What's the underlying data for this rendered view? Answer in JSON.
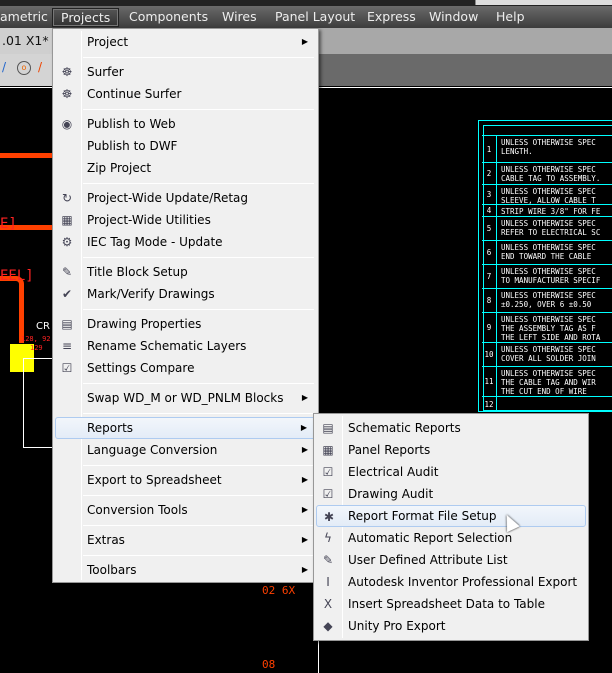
{
  "menubar": {
    "items": [
      {
        "label": "ametric"
      },
      {
        "label": "Projects"
      },
      {
        "label": "Components"
      },
      {
        "label": "Wires"
      },
      {
        "label": "Panel Layout"
      },
      {
        "label": "Express"
      },
      {
        "label": "Window"
      },
      {
        "label": "Help"
      }
    ]
  },
  "document_tab": {
    "label": ".01 X1*"
  },
  "projects_menu": {
    "items": [
      {
        "label": "Project",
        "icon": "none",
        "submenu": true
      },
      {
        "label": "Surfer",
        "icon": "surfer-icon"
      },
      {
        "label": "Continue Surfer",
        "icon": "continue-surfer-icon"
      },
      {
        "label": "Publish to Web",
        "icon": "globe-icon"
      },
      {
        "label": "Publish to DWF",
        "icon": "none"
      },
      {
        "label": "Zip Project",
        "icon": "none"
      },
      {
        "label": "Project-Wide Update/Retag",
        "icon": "update-icon"
      },
      {
        "label": "Project-Wide Utilities",
        "icon": "utilities-icon"
      },
      {
        "label": "IEC Tag Mode - Update",
        "icon": "iec-tag-icon"
      },
      {
        "label": "Title Block Setup",
        "icon": "title-block-icon"
      },
      {
        "label": "Mark/Verify Drawings",
        "icon": "check-icon"
      },
      {
        "label": "Drawing Properties",
        "icon": "properties-icon"
      },
      {
        "label": "Rename Schematic Layers",
        "icon": "rename-layers-icon"
      },
      {
        "label": "Settings Compare",
        "icon": "compare-icon"
      },
      {
        "label": "Swap WD_M or WD_PNLM Blocks",
        "icon": "none",
        "submenu": true
      },
      {
        "label": "Reports",
        "icon": "none",
        "submenu": true,
        "highlighted": true
      },
      {
        "label": "Language Conversion",
        "icon": "none",
        "submenu": true
      },
      {
        "label": "Export to Spreadsheet",
        "icon": "none",
        "submenu": true
      },
      {
        "label": "Conversion Tools",
        "icon": "none",
        "submenu": true
      },
      {
        "label": "Extras",
        "icon": "none",
        "submenu": true
      },
      {
        "label": "Toolbars",
        "icon": "none",
        "submenu": true
      }
    ]
  },
  "reports_submenu": {
    "items": [
      {
        "label": "Schematic Reports",
        "icon": "schematic-report-icon"
      },
      {
        "label": "Panel Reports",
        "icon": "panel-report-icon"
      },
      {
        "label": "Electrical Audit",
        "icon": "electrical-audit-icon"
      },
      {
        "label": "Drawing Audit",
        "icon": "drawing-audit-icon"
      },
      {
        "label": "Report Format File Setup",
        "icon": "report-format-icon",
        "highlighted": true
      },
      {
        "label": "Automatic Report Selection",
        "icon": "auto-report-icon"
      },
      {
        "label": "User Defined Attribute List",
        "icon": "attribute-list-icon"
      },
      {
        "label": "Autodesk Inventor Professional Export",
        "icon": "inventor-export-icon"
      },
      {
        "label": "Insert Spreadsheet Data to Table",
        "icon": "excel-icon"
      },
      {
        "label": "Unity Pro Export",
        "icon": "unity-export-icon"
      }
    ]
  },
  "drawing": {
    "notes": [
      {
        "n": "1",
        "text": "UNLESS OTHERWISE SPEC\nLENGTH."
      },
      {
        "n": "2",
        "text": "UNLESS OTHERWISE SPEC\nCABLE TAG TO ASSEMBLY."
      },
      {
        "n": "3",
        "text": "UNLESS OTHERWISE SPEC\nSLEEVE, ALLOW CABLE T"
      },
      {
        "n": "4",
        "text": "STRIP WIRE 3/8\" FOR FE"
      },
      {
        "n": "5",
        "text": "UNLESS OTHERWISE SPEC\nREFER TO ELECTRICAL SC"
      },
      {
        "n": "6",
        "text": "UNLESS OTHERWISE SPEC\nEND TOWARD THE CABLE"
      },
      {
        "n": "7",
        "text": "UNLESS OTHERWISE SPEC\nTO MANUFACTURER SPECIF"
      },
      {
        "n": "8",
        "text": "UNLESS OTHERWISE SPEC\n±0.250, OVER 6 ±0.50"
      },
      {
        "n": "9",
        "text": "UNLESS OTHERWISE SPEC\nTHE ASSEMBLY TAG AS F\nTHE LEFT SIDE AND ROTA"
      },
      {
        "n": "10",
        "text": "UNLESS OTHERWISE SPEC\nCOVER ALL SOLDER JOIN"
      },
      {
        "n": "11",
        "text": "UNLESS OTHERWISE SPEC\nTHE CABLE TAG AND WIR\nTHE CUT END OF WIRE"
      },
      {
        "n": "12",
        "text": ""
      }
    ],
    "labels": {
      "a": "E]",
      "b": "EEL]",
      "c": "CR",
      "d": "128, 92",
      "e": "129",
      "f": "02 6X",
      "g": "08"
    }
  },
  "colors": {
    "accent_red": "#ff4000",
    "cyan": "#00ffff",
    "yellow": "#ffff00"
  }
}
